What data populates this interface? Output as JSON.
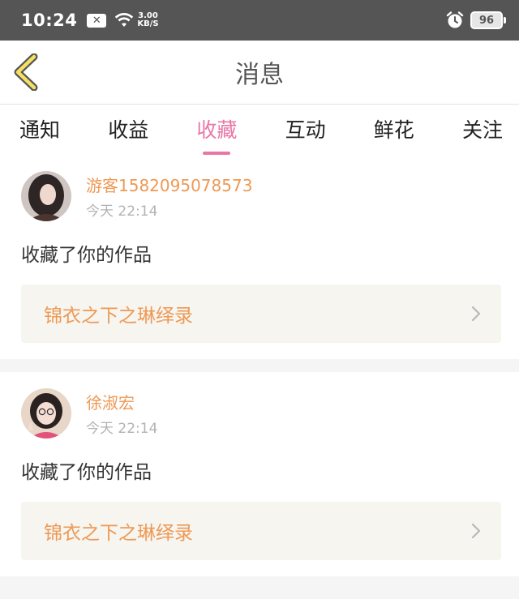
{
  "status_bar": {
    "time": "10:24",
    "speed_value": "3.00",
    "speed_unit": "KB/S",
    "battery": "96"
  },
  "header": {
    "title": "消息"
  },
  "tabs": [
    {
      "label": "通知",
      "active": false
    },
    {
      "label": "收益",
      "active": false
    },
    {
      "label": "收藏",
      "active": true
    },
    {
      "label": "互动",
      "active": false
    },
    {
      "label": "鲜花",
      "active": false
    },
    {
      "label": "关注",
      "active": false
    }
  ],
  "messages": [
    {
      "username": "游客1582095078573",
      "time": "今天 22:14",
      "action": "收藏了你的作品",
      "work_title": "锦衣之下之琳绎录"
    },
    {
      "username": "徐淑宏",
      "time": "今天 22:14",
      "action": "收藏了你的作品",
      "work_title": "锦衣之下之琳绎录"
    }
  ],
  "colors": {
    "accent_pink": "#e977a6",
    "username_orange": "#ee9955",
    "status_bar_bg": "#555555"
  },
  "icons": {
    "back": "back-chevron-icon",
    "arrow": "chevron-right-icon"
  }
}
